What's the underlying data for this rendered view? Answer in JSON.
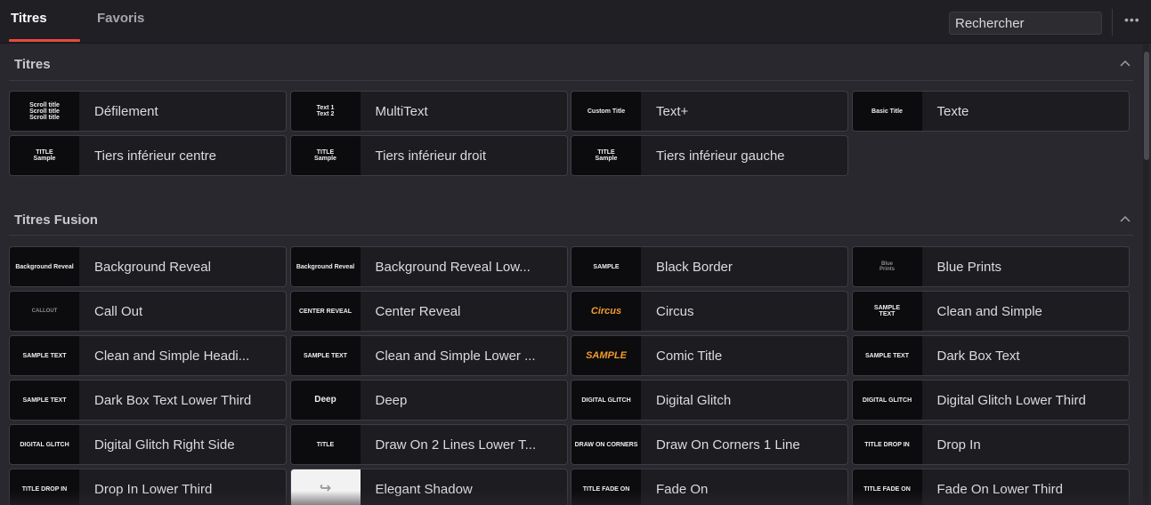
{
  "tabs": [
    {
      "label": "Titres",
      "active": true
    },
    {
      "label": "Favoris",
      "active": false
    }
  ],
  "search": {
    "placeholder": "Rechercher"
  },
  "more_icon": "more-horizontal-icon",
  "accent_color": "#e64b3c",
  "sections": [
    {
      "title": "Titres",
      "collapse_icon": "chevron-up-icon",
      "items": [
        {
          "label": "Défilement",
          "thumb": "Scroll title\nScroll title\nScroll title"
        },
        {
          "label": "MultiText",
          "thumb": "Text 1\nText 2"
        },
        {
          "label": "Text+",
          "thumb": "Custom Title"
        },
        {
          "label": "Texte",
          "thumb": "Basic Title"
        },
        {
          "label": "Tiers inférieur centre",
          "thumb": "TITLE\nSample"
        },
        {
          "label": "Tiers inférieur droit",
          "thumb": "TITLE\nSample"
        },
        {
          "label": "Tiers inférieur gauche",
          "thumb": "TITLE\nSample"
        }
      ]
    },
    {
      "title": "Titres Fusion",
      "collapse_icon": "chevron-up-icon",
      "items": [
        {
          "label": "Background Reveal",
          "thumb": "Background Reveal"
        },
        {
          "label": "Background Reveal Low...",
          "thumb": "Background Reveal"
        },
        {
          "label": "Black Border",
          "thumb": "SAMPLE"
        },
        {
          "label": "Blue Prints",
          "thumb": "Blue\nPrints"
        },
        {
          "label": "Call Out",
          "thumb": "CALLOUT"
        },
        {
          "label": "Center Reveal",
          "thumb": "CENTER REVEAL"
        },
        {
          "label": "Circus",
          "thumb": "Circus"
        },
        {
          "label": "Clean and Simple",
          "thumb": "SAMPLE\nTEXT"
        },
        {
          "label": "Clean and Simple Headi...",
          "thumb": "SAMPLE TEXT"
        },
        {
          "label": "Clean and Simple Lower ...",
          "thumb": "SAMPLE TEXT"
        },
        {
          "label": "Comic Title",
          "thumb": "SAMPLE"
        },
        {
          "label": "Dark Box Text",
          "thumb": "SAMPLE TEXT"
        },
        {
          "label": "Dark Box Text Lower Third",
          "thumb": "SAMPLE TEXT"
        },
        {
          "label": "Deep",
          "thumb": "Deep"
        },
        {
          "label": "Digital Glitch",
          "thumb": "DIGITAL GLITCH"
        },
        {
          "label": "Digital Glitch Lower Third",
          "thumb": "DIGITAL GLITCH"
        },
        {
          "label": "Digital Glitch Right Side",
          "thumb": "DIGITAL GLITCH"
        },
        {
          "label": "Draw On 2 Lines Lower T...",
          "thumb": "TITLE"
        },
        {
          "label": "Draw On Corners 1 Line",
          "thumb": "DRAW ON CORNERS"
        },
        {
          "label": "Drop In",
          "thumb": "TITLE DROP IN"
        },
        {
          "label": "Drop In Lower Third",
          "thumb": "TITLE DROP IN"
        },
        {
          "label": "Elegant Shadow",
          "thumb": "↪"
        },
        {
          "label": "Fade On",
          "thumb": "TITLE FADE ON"
        },
        {
          "label": "Fade On Lower Third",
          "thumb": "TITLE FADE ON"
        }
      ]
    }
  ]
}
